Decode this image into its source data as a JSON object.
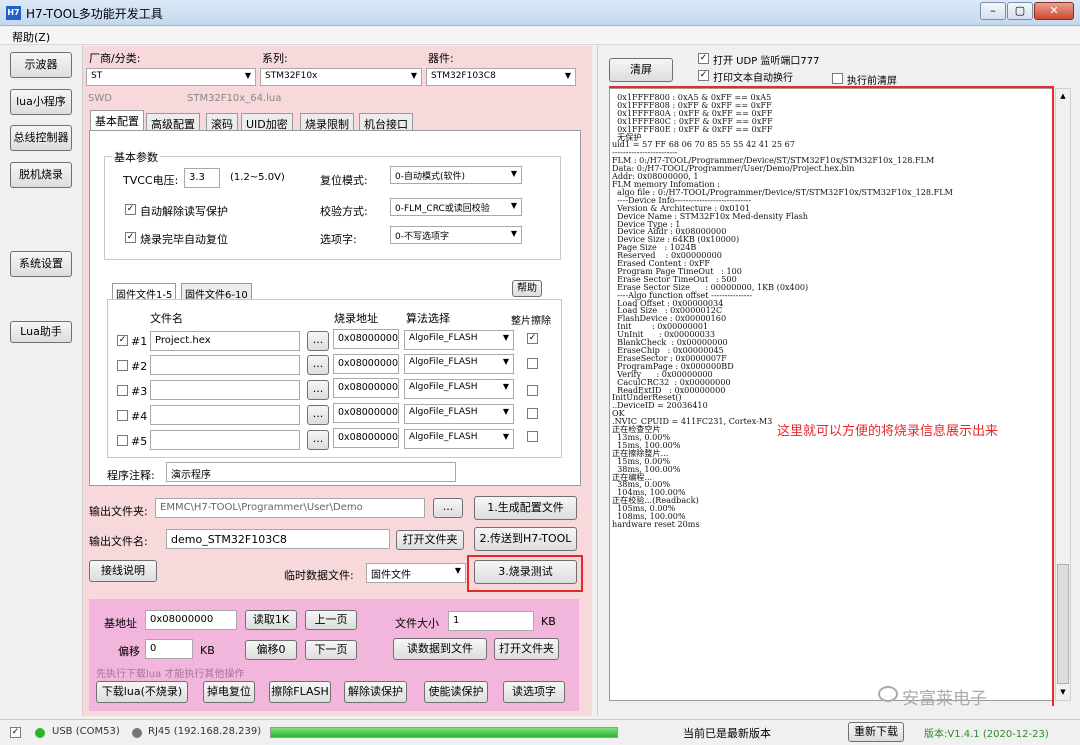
{
  "window": {
    "icon_label": "H7",
    "title": "H7-TOOL多功能开发工具"
  },
  "menu": {
    "help": "帮助(Z)"
  },
  "sidebar": {
    "items": [
      "示波器",
      "lua小程序",
      "总线控制器",
      "脱机烧录",
      "系统设置",
      "Lua助手"
    ]
  },
  "device": {
    "vendor_label": "厂商/分类:",
    "vendor_value": "ST",
    "series_label": "系列:",
    "series_value": "STM32F10x",
    "part_label": "器件:",
    "part_value": "STM32F103C8",
    "swd": "SWD",
    "lua_file": "STM32F10x_64.lua"
  },
  "tabs": [
    "基本配置",
    "高级配置",
    "滚码",
    "UID加密",
    "烧录限制",
    "机台接口"
  ],
  "basic": {
    "group_title": "基本参数",
    "tvcc_label": "TVCC电压:",
    "tvcc_value": "3.3",
    "tvcc_range": "(1.2~5.0V)",
    "reset_label": "复位模式:",
    "reset_value": "0-自动模式(软件)",
    "auto_unlock": "自动解除读写保护",
    "verify_label": "校验方式:",
    "verify_value": "0-FLM_CRC或读回校验",
    "auto_reset": "烧录完毕自动复位",
    "option_label": "选项字:",
    "option_value": "0-不写选项字"
  },
  "files": {
    "tab1": "固件文件1-5",
    "tab2": "固件文件6-10",
    "help": "帮助",
    "col_name": "文件名",
    "col_addr": "烧录地址",
    "col_algo": "算法选择",
    "col_erase": "整片擦除",
    "rows": [
      {
        "idx": "#1",
        "checked": "✓",
        "name": "Project.hex",
        "addr": "0x08000000",
        "algo": "AlgoFile_FLASH",
        "erase": "✓"
      },
      {
        "idx": "#2",
        "checked": "",
        "name": "",
        "addr": "0x08000000",
        "algo": "AlgoFile_FLASH",
        "erase": ""
      },
      {
        "idx": "#3",
        "checked": "",
        "name": "",
        "addr": "0x08000000",
        "algo": "AlgoFile_FLASH",
        "erase": ""
      },
      {
        "idx": "#4",
        "checked": "",
        "name": "",
        "addr": "0x08000000",
        "algo": "AlgoFile_FLASH",
        "erase": ""
      },
      {
        "idx": "#5",
        "checked": "",
        "name": "",
        "addr": "0x08000000",
        "algo": "AlgoFile_FLASH",
        "erase": ""
      }
    ],
    "browse": "..."
  },
  "note": {
    "label": "程序注释:",
    "value": "演示程序"
  },
  "output": {
    "folder_label": "输出文件夹:",
    "folder_value": "EMMC\\H7-TOOL\\Programmer\\User\\Demo",
    "browse": "...",
    "gen_button": "1.生成配置文件",
    "name_label": "输出文件名:",
    "name_value": "demo_STM32F103C8",
    "open_folder": "打开文件夹",
    "send_button": "2.传送到H7-TOOL",
    "wiring": "接线说明",
    "temp_label": "临时数据文件:",
    "temp_value": "固件文件",
    "test_button": "3.烧录测试"
  },
  "memory": {
    "base_label": "基地址",
    "base_value": "0x08000000",
    "read1k": "读取1K",
    "prev_page": "上一页",
    "size_label": "文件大小",
    "size_value": "1",
    "size_unit": "KB",
    "offset_label": "偏移",
    "offset_value": "0",
    "offset_unit": "KB",
    "offset0": "偏移0",
    "next_page": "下一页",
    "read_to_file": "读数据到文件",
    "open_folder": "打开文件夹",
    "hint": "先执行下载lua 才能执行其他操作",
    "download_lua": "下载lua(不烧录)",
    "power_reset": "掉电复位",
    "erase_flash": "擦除FLASH",
    "unlock": "解除读保护",
    "enable_protect": "使能读保护",
    "read_option": "读选项字"
  },
  "logpanel": {
    "clear": "清屏",
    "udp": "打开 UDP 监听端口777",
    "autowrap": "打印文本自动换行",
    "clear_before": "执行前清屏",
    "annotation": "这里就可以方便的将烧录信息展示出来",
    "watermark": "安富莱电子"
  },
  "log": [
    "  0x1FFFF800 : 0xA5 & 0xFF == 0xA5",
    "  0x1FFFF808 : 0xFF & 0xFF == 0xFF",
    "  0x1FFFF80A : 0xFF & 0xFF == 0xFF",
    "  0x1FFFF80C : 0xFF & 0xFF == 0xFF",
    "  0x1FFFF80E : 0xFF & 0xFF == 0xFF",
    "  无保护",
    "uid1 = 57 FF 68 06 70 85 55 55 42 41 25 67",
    "------------------------",
    "FLM : 0:/H7-TOOL/Programmer/Device/ST/STM32F10x/STM32F10x_128.FLM",
    "Data: 0:/H7-TOOL/Programmer/User/Demo/Project.hex.bin",
    "Addr: 0x08000000, 1",
    "FLM memory Infomation :",
    "  algo file : 0:/H7-TOOL/Programmer/Device/ST/STM32F10x/STM32F10x_128.FLM",
    "  ----Device Info----------------------------",
    "  Version & Architecture : 0x0101",
    "  Device Name : STM32F10x Med-density Flash",
    "  Device Type : 1",
    "  Device Addr : 0x08000000",
    "  Device Size : 64KB (0x10000)",
    "  Page Size   : 1024B",
    "  Reserved    : 0x00000000",
    "  Erased Content : 0xFF",
    "  Program Page TimeOut   : 100",
    "  Erase Sector TimeOut   : 500",
    "  Erase Sector Size      : 00000000, 1KB (0x400)",
    "  ----Algo function offset ---------------",
    "  Load Offset : 0x00000034",
    "  Load Size   : 0x0000012C",
    "  FlashDevice : 0x00000160",
    "  Init        : 0x00000001",
    "  UnInit      : 0x00000033",
    "  BlankCheck  : 0x00000000",
    "  EraseChip   : 0x00000045",
    "  EraseSector : 0x0000007F",
    "  ProgramPage : 0x000000BD",
    "  Verify      : 0x00000000",
    "  CaculCRC32  : 0x00000000",
    "  ReadExtID   : 0x00000000",
    "InitUnderReset()",
    "..DeviceID = 20036410",
    "OK",
    ".NVIC_CPUID = 411FC231, Cortex-M3",
    "正在检查空片",
    "  13ms, 0.00%",
    "  15ms, 100.00%",
    "正在擦除整片...",
    "  15ms, 0.00%",
    "  38ms, 100.00%",
    "正在编程...",
    "  38ms, 0.00%",
    "  104ms, 100.00%",
    "正在校验...(Readback)",
    "  105ms, 0.00%",
    "  108ms, 100.00%",
    "hardware reset 20ms"
  ],
  "statusbar": {
    "usb": "USB (COM53)",
    "rj45": "RJ45 (192.168.28.239)",
    "progress": 1.0,
    "version_msg": "当前已是最新版本",
    "redownload": "重新下载",
    "version": "版本:V1.4.1 (2020-12-23)"
  },
  "colors": {
    "pink": "#f7d9dc",
    "magenta": "#f2b6dc",
    "red_annotation": "#e8282a",
    "green": "#2db52d"
  }
}
